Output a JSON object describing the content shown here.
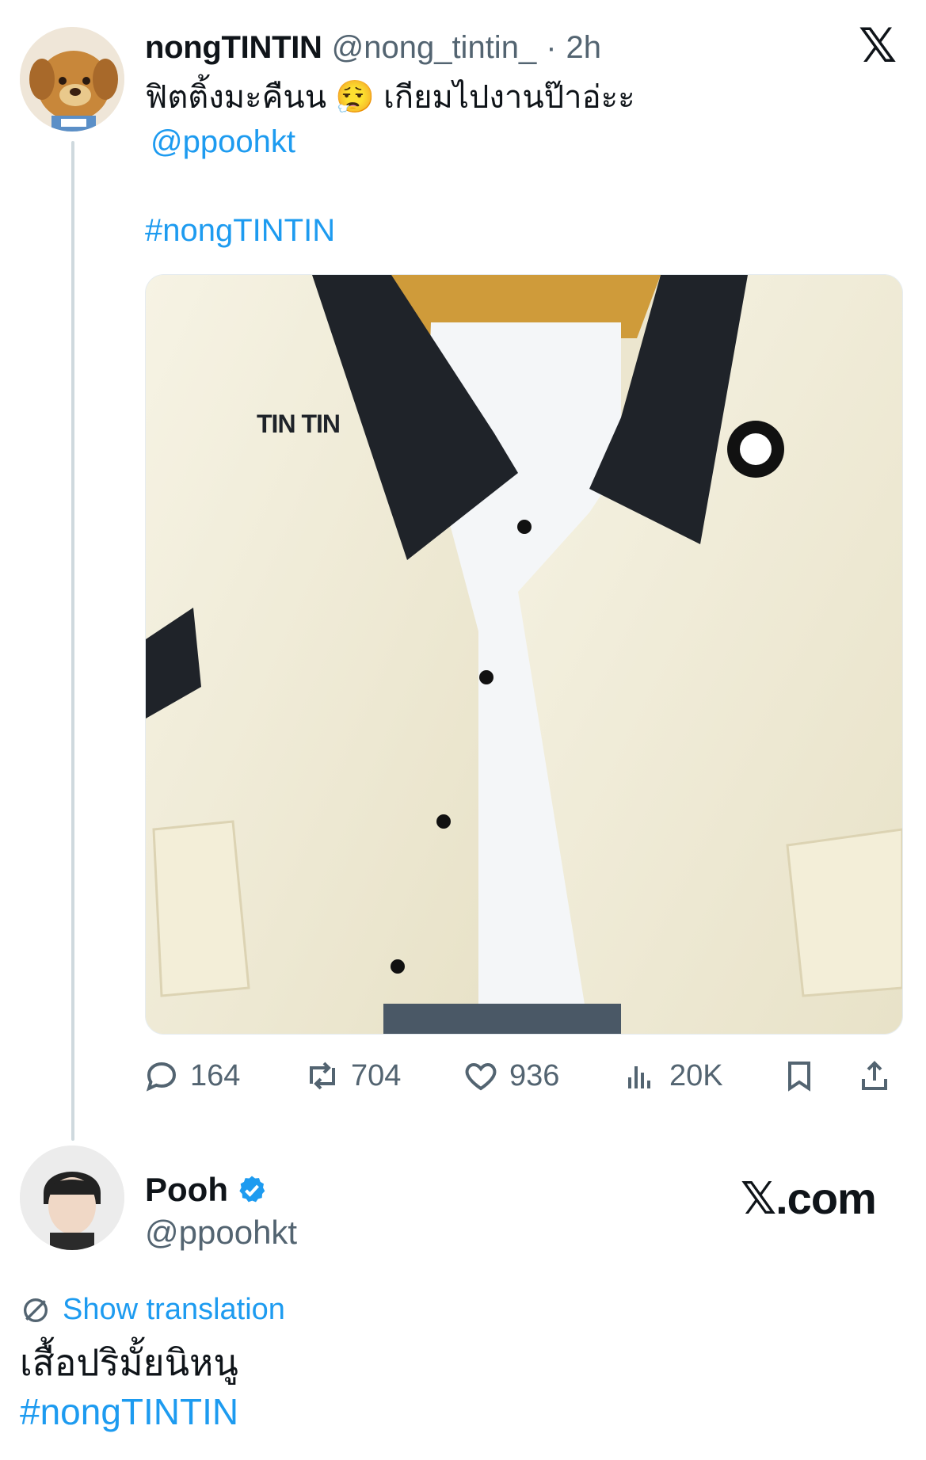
{
  "tweet": {
    "display_name": "nongTINTIN",
    "handle": "@nong_tintin_",
    "time": "2h",
    "separator": "·",
    "text_line1": "ฟิตติ้งมะคืนน",
    "emoji": "😮‍💨",
    "text_line1_after": "เกียมไปงานป๊าอ่ะะ",
    "mention": "@ppoohkt",
    "hashtag": "#nongTINTIN",
    "media_label": "TIN TIN",
    "stats": {
      "replies": "164",
      "reposts": "704",
      "likes": "936",
      "views": "20K"
    }
  },
  "reply": {
    "display_name": "Pooh",
    "handle": "@ppoohkt",
    "verified": true,
    "show_translation": "Show translation",
    "text": "เสื้อปริมั้ยนิหนู",
    "hashtag": "#nongTINTIN"
  },
  "branding": {
    "x_logo": "𝕏",
    "xcom_label": "𝕏.com"
  },
  "colors": {
    "accent": "#1d9bf0",
    "muted": "#536471",
    "text": "#0f1419"
  }
}
